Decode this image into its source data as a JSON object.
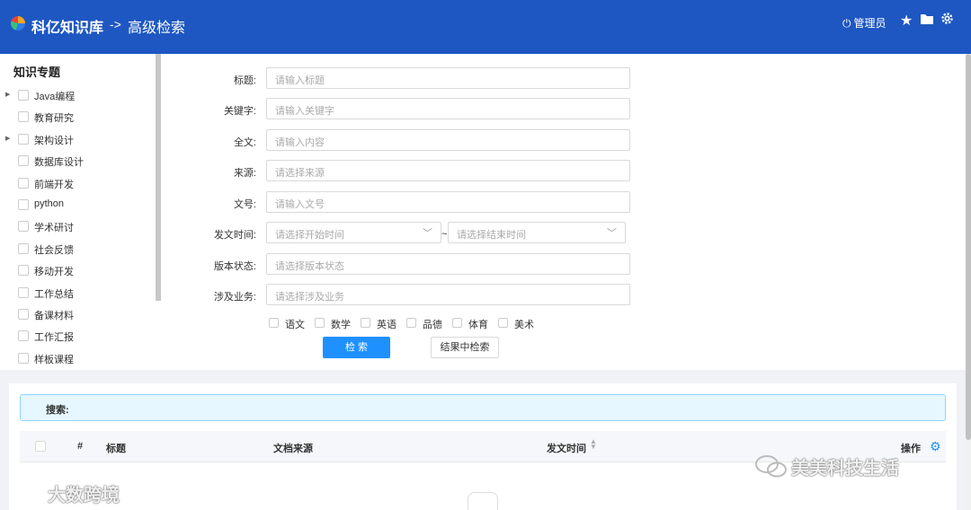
{
  "header": {
    "app_title": "科亿知识库",
    "crumb_arrow": "->",
    "crumb_page": "高级检索",
    "admin_label": "管理员",
    "icons": [
      "star-icon",
      "folder-icon",
      "gear-icon"
    ],
    "accent_color": "#1e57c2"
  },
  "sidebar": {
    "title": "知识专题",
    "items": [
      {
        "label": "Java编程",
        "expandable": true
      },
      {
        "label": "教育研究",
        "expandable": false
      },
      {
        "label": "架构设计",
        "expandable": true
      },
      {
        "label": "数据库设计",
        "expandable": false
      },
      {
        "label": "前端开发",
        "expandable": false
      },
      {
        "label": "python",
        "expandable": false
      },
      {
        "label": "学术研讨",
        "expandable": false
      },
      {
        "label": "社会反馈",
        "expandable": false
      },
      {
        "label": "移动开发",
        "expandable": false
      },
      {
        "label": "工作总结",
        "expandable": false
      },
      {
        "label": "备课材料",
        "expandable": false
      },
      {
        "label": "工作汇报",
        "expandable": false
      },
      {
        "label": "样板课程",
        "expandable": false
      }
    ]
  },
  "form": {
    "title_label": "标题:",
    "title_placeholder": "请输入标题",
    "keyword_label": "关键字:",
    "keyword_placeholder": "请输入关键字",
    "fulltext_label": "全文:",
    "fulltext_placeholder": "请输入内容",
    "source_label": "来源:",
    "source_placeholder": "请选择来源",
    "docno_label": "文号:",
    "docno_placeholder": "请输入文号",
    "date_label": "发文时间:",
    "date_start_placeholder": "请选择开始时间",
    "date_separator": "~",
    "date_end_placeholder": "请选择结束时间",
    "version_label": "版本状态:",
    "version_placeholder": "请选择版本状态",
    "business_label": "涉及业务:",
    "business_placeholder": "请选择涉及业务",
    "subjects": [
      "语文",
      "数学",
      "英语",
      "品德",
      "体育",
      "美术"
    ],
    "search_button": "检 索",
    "search_within_button": "结果中检索",
    "primary_color": "#1e90ff"
  },
  "results": {
    "search_label": "搜索:",
    "columns": {
      "index": "#",
      "title": "标题",
      "source": "文档来源",
      "date": "发文时间",
      "actions": "操作"
    }
  },
  "watermarks": {
    "right": "美美科技生活",
    "left": "大数跨境"
  }
}
